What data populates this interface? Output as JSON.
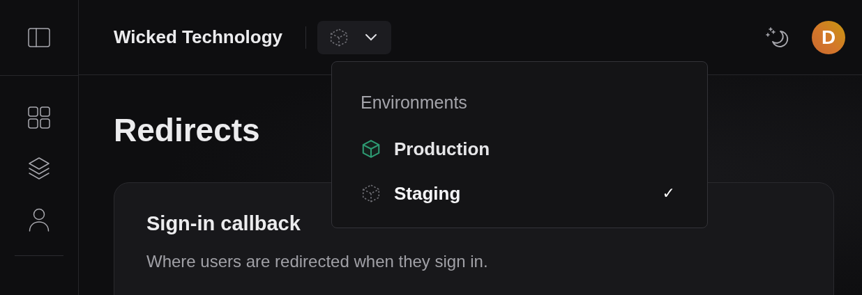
{
  "header": {
    "org_name": "Wicked Technology",
    "avatar_initial": "D"
  },
  "page": {
    "title": "Redirects"
  },
  "card": {
    "title": "Sign-in callback",
    "description": "Where users are redirected when they sign in."
  },
  "environment_menu": {
    "heading": "Environments",
    "items": [
      {
        "label": "Production",
        "kind": "solid",
        "selected": false
      },
      {
        "label": "Staging",
        "kind": "dashed",
        "selected": true
      }
    ],
    "check": "✓"
  }
}
